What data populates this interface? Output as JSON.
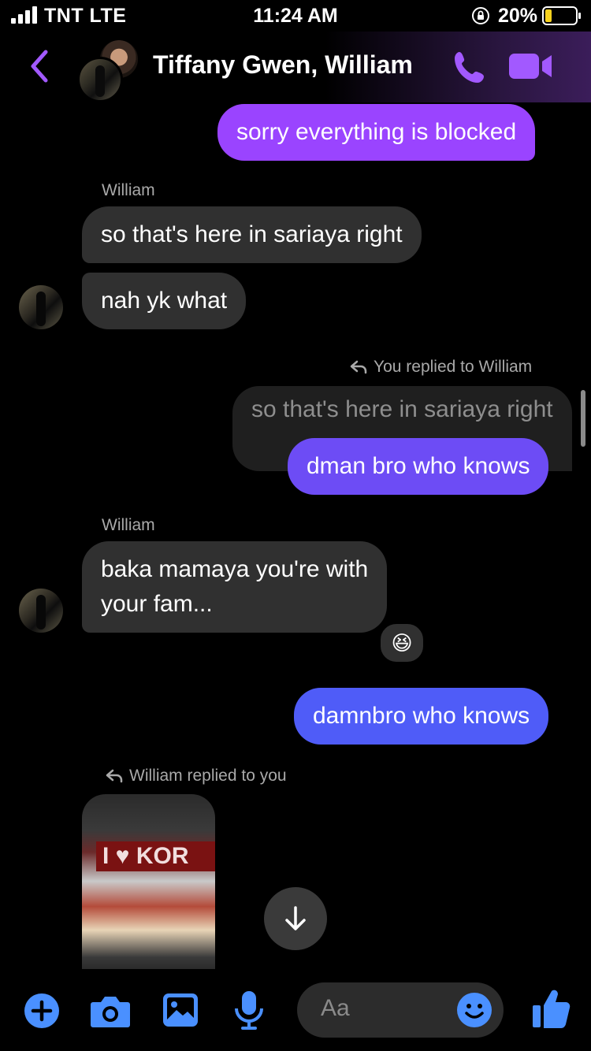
{
  "status": {
    "carrier": "TNT  LTE",
    "time": "11:24 AM",
    "battery_pct": "20%"
  },
  "header": {
    "title": "Tiffany Gwen, William",
    "accent": "#a259ff"
  },
  "messages": {
    "m1": "sorry everything is blocked",
    "sender1": "William",
    "m2": "so that's here in sariaya right",
    "m3": "nah yk what",
    "reply_label1": "You replied to William",
    "quoted1": "so that's here in sariaya right",
    "m4": "dman bro who knows",
    "sender2": "William",
    "m5_line1": "baka mamaya you're with",
    "m5_line2": "your fam...",
    "reaction": "😆",
    "m6": "damnbro who knows",
    "reply_label2": "William replied to you",
    "photo_sign": "I ♥ KOR"
  },
  "composer": {
    "placeholder": "Aa",
    "accent": "#4a90ff"
  }
}
